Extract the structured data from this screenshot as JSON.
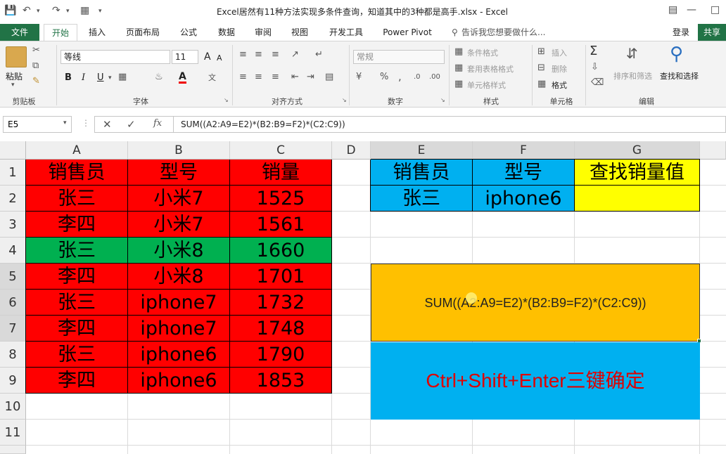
{
  "window": {
    "title": "Excel居然有11种方法实现多条件查询，知道其中的3种都是高手.xlsx - Excel"
  },
  "tabs": {
    "file": "文件",
    "home": "开始",
    "insert": "插入",
    "layout": "页面布局",
    "formulas": "公式",
    "data": "数据",
    "review": "审阅",
    "view": "视图",
    "developer": "开发工具",
    "powerpivot": "Power Pivot",
    "tellme": "告诉我您想要做什么...",
    "login": "登录",
    "share": "共享"
  },
  "ribbon": {
    "clipboard": {
      "paste": "粘贴",
      "label": "剪贴板"
    },
    "font": {
      "name": "等线",
      "size": "11",
      "label": "字体",
      "grow": "A",
      "shrink": "A",
      "bold": "B",
      "italic": "I",
      "underline": "U"
    },
    "alignment": {
      "label": "对齐方式"
    },
    "number": {
      "format": "常规",
      "percent": "%",
      "comma": ",",
      "label": "数字"
    },
    "styles": {
      "conditional": "条件格式",
      "table": "套用表格格式",
      "cell": "单元格样式",
      "label": "样式"
    },
    "cells": {
      "insert": "插入",
      "delete": "删除",
      "format": "格式",
      "label": "单元格"
    },
    "editing": {
      "sortfilter": "排序和筛选",
      "findselect": "查找和选择",
      "label": "编辑"
    }
  },
  "formula_bar": {
    "name_box": "E5",
    "formula": "SUM((A2:A9=E2)*(B2:B9=F2)*(C2:C9))"
  },
  "columns": [
    "A",
    "B",
    "C",
    "D",
    "E",
    "F",
    "G"
  ],
  "rows": [
    "1",
    "2",
    "3",
    "4",
    "5",
    "6",
    "7",
    "8",
    "9",
    "10",
    "11"
  ],
  "table": {
    "headers": [
      "销售员",
      "型号",
      "销量"
    ],
    "rows": [
      [
        "张三",
        "小米7",
        "1525"
      ],
      [
        "李四",
        "小米7",
        "1561"
      ],
      [
        "张三",
        "小米8",
        "1660"
      ],
      [
        "李四",
        "小米8",
        "1701"
      ],
      [
        "张三",
        "iphone7",
        "1732"
      ],
      [
        "李四",
        "iphone7",
        "1748"
      ],
      [
        "张三",
        "iphone6",
        "1790"
      ],
      [
        "李四",
        "iphone6",
        "1853"
      ]
    ]
  },
  "lookup": {
    "headers": [
      "销售员",
      "型号",
      "查找销量值"
    ],
    "values": [
      "张三",
      "iphone6",
      ""
    ]
  },
  "annotation": {
    "formula_display": "SUM((A2:A9=E2)*(B2:B9=F2)*(C2:C9))",
    "hint": "Ctrl+Shift+Enter三键确定"
  },
  "colors": {
    "excel_green": "#217346",
    "table_red": "#ff0000",
    "highlight_green": "#00b050",
    "lookup_blue": "#00b0f0",
    "result_yellow": "#ffff00",
    "formula_orange": "#ffc000",
    "hint_text": "#e00000"
  }
}
